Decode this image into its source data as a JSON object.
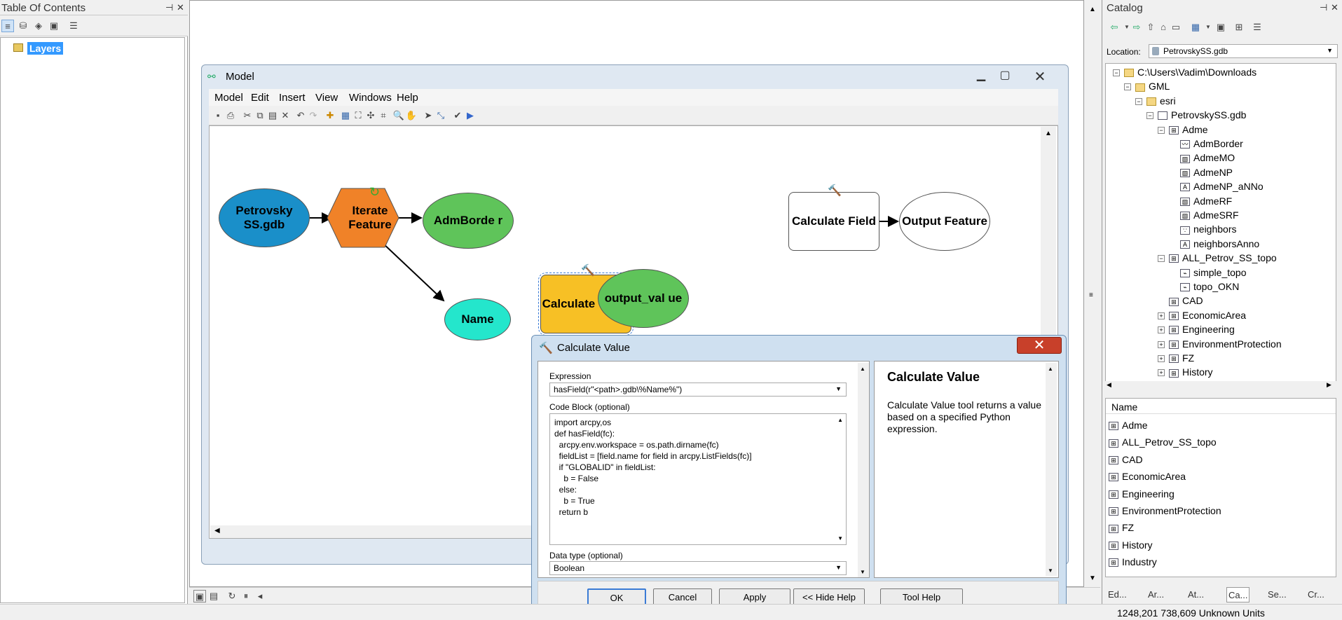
{
  "toc": {
    "title": "Table Of Contents",
    "pin": "⊣",
    "close": "✕",
    "layers": "Layers"
  },
  "model": {
    "title": "Model",
    "menu": [
      "Model",
      "Edit",
      "Insert",
      "View",
      "Windows",
      "Help"
    ],
    "nodes": {
      "petrovsky": "Petrovsky SS.gdb",
      "iterate": "Iterate Feature",
      "admborder": "AdmBorde r",
      "name": "Name",
      "calcvalue": "Calculate Value",
      "output_value": "output_val ue",
      "calcfield": "Calculate Field",
      "output_feature": "Output Feature"
    },
    "colors": {
      "petrovsky": "#1a8fc9",
      "iterate": "#f08228",
      "green": "#5fc45a",
      "name": "#24e6cc",
      "calcvalue": "#f7c025",
      "white": "#ffffff"
    }
  },
  "calc_dialog": {
    "title": "Calculate Value",
    "close": "✕",
    "expression_label": "Expression",
    "expression_value": "hasField(r\"<path>.gdb\\%Name%\")",
    "codeblock_label": "Code Block (optional)",
    "code_lines": [
      "import arcpy,os",
      "def hasField(fc):",
      "  arcpy.env.workspace = os.path.dirname(fc)",
      "  fieldList = [field.name for field in arcpy.ListFields(fc)]",
      "  if \"GLOBALID\" in fieldList:",
      "    b = False",
      "  else:",
      "    b = True",
      "  return b"
    ],
    "datatype_label": "Data type (optional)",
    "datatype_value": "Boolean",
    "help_title": "Calculate Value",
    "help_text": "Calculate Value tool returns a value based on a specified Python expression.",
    "buttons": {
      "ok": "OK",
      "cancel": "Cancel",
      "apply": "Apply",
      "hide_help": "<< Hide Help",
      "tool_help": "Tool Help"
    }
  },
  "catalog": {
    "title": "Catalog",
    "location_label": "Location:",
    "location_value": "PetrovskySS.gdb",
    "tree": [
      {
        "label": "C:\\Users\\Vadim\\Downloads",
        "indent": 0,
        "exp": "−",
        "icon": "folder"
      },
      {
        "label": "GML",
        "indent": 1,
        "exp": "−",
        "icon": "folder"
      },
      {
        "label": "esri",
        "indent": 2,
        "exp": "−",
        "icon": "folder"
      },
      {
        "label": "PetrovskySS.gdb",
        "indent": 3,
        "exp": "−",
        "icon": "gdb"
      },
      {
        "label": "Adme",
        "indent": 4,
        "exp": "−",
        "icon": "fds"
      },
      {
        "label": "AdmBorder",
        "indent": 5,
        "exp": "",
        "icon": "line"
      },
      {
        "label": "AdmeMO",
        "indent": 5,
        "exp": "",
        "icon": "poly"
      },
      {
        "label": "AdmeNP",
        "indent": 5,
        "exp": "",
        "icon": "poly"
      },
      {
        "label": "AdmeNP_aNNo",
        "indent": 5,
        "exp": "",
        "icon": "anno"
      },
      {
        "label": "AdmeRF",
        "indent": 5,
        "exp": "",
        "icon": "poly"
      },
      {
        "label": "AdmeSRF",
        "indent": 5,
        "exp": "",
        "icon": "poly"
      },
      {
        "label": "neighbors",
        "indent": 5,
        "exp": "",
        "icon": "point"
      },
      {
        "label": "neighborsAnno",
        "indent": 5,
        "exp": "",
        "icon": "anno"
      },
      {
        "label": "ALL_Petrov_SS_topo",
        "indent": 4,
        "exp": "−",
        "icon": "fds"
      },
      {
        "label": "simple_topo",
        "indent": 5,
        "exp": "",
        "icon": "topo"
      },
      {
        "label": "topo_OKN",
        "indent": 5,
        "exp": "",
        "icon": "topo"
      },
      {
        "label": "CAD",
        "indent": 4,
        "exp": "",
        "icon": "fds"
      },
      {
        "label": "EconomicArea",
        "indent": 4,
        "exp": "+",
        "icon": "fds"
      },
      {
        "label": "Engineering",
        "indent": 4,
        "exp": "+",
        "icon": "fds"
      },
      {
        "label": "EnvironmentProtection",
        "indent": 4,
        "exp": "+",
        "icon": "fds"
      },
      {
        "label": "FZ",
        "indent": 4,
        "exp": "+",
        "icon": "fds"
      },
      {
        "label": "History",
        "indent": 4,
        "exp": "+",
        "icon": "fds"
      }
    ],
    "list_header": "Name",
    "list": [
      "Adme",
      "ALL_Petrov_SS_topo",
      "CAD",
      "EconomicArea",
      "Engineering",
      "EnvironmentProtection",
      "FZ",
      "History",
      "Industry"
    ],
    "tabs": [
      "Ed...",
      "Ar...",
      "At...",
      "Ca...",
      "Se...",
      "Cr..."
    ]
  },
  "status": {
    "coords": "1248,201  738,609 Unknown Units"
  }
}
